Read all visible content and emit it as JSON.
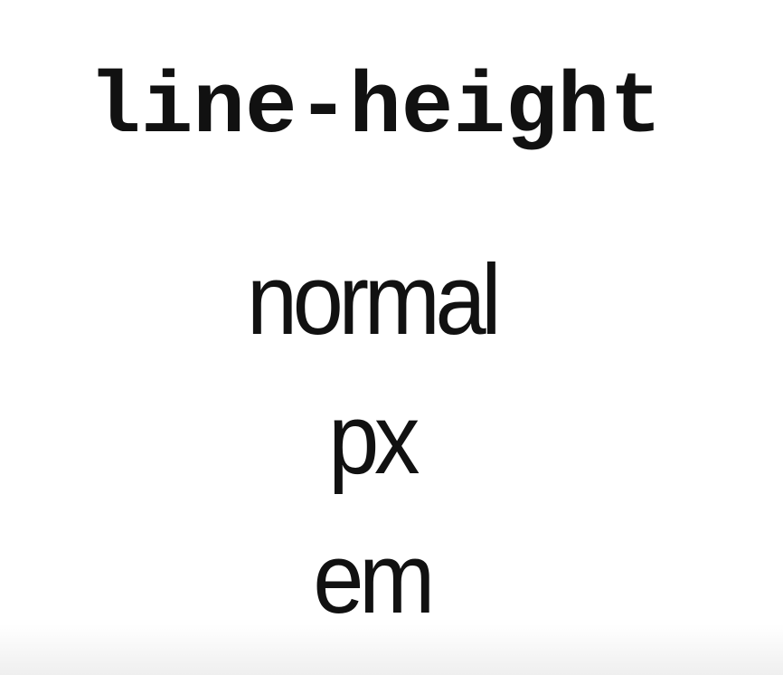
{
  "slide": {
    "title": "line-height",
    "values": [
      "normal",
      "px",
      "em"
    ]
  },
  "colors": {
    "background": "#ffffff",
    "text": "#111111"
  }
}
